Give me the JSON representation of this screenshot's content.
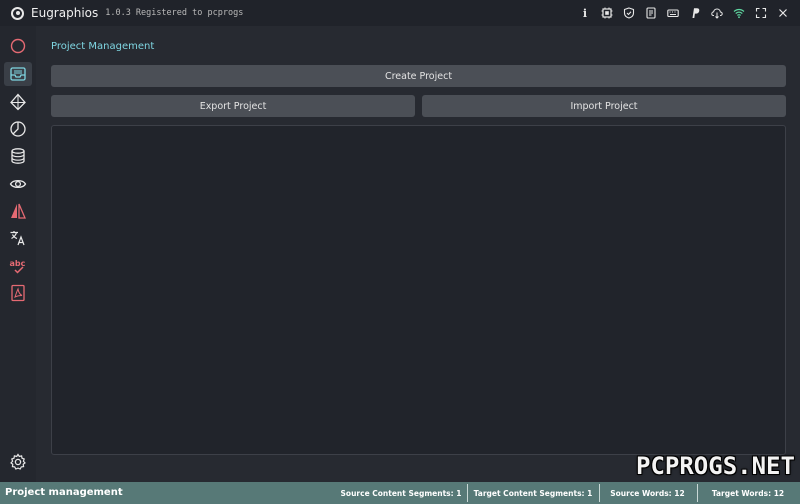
{
  "window": {
    "app_name": "Eugraphios",
    "version": "1.0.3",
    "registration": "Registered to pcprogs",
    "info_label": "i",
    "title_icons": [
      "info-icon",
      "chip-icon",
      "shield-check-icon",
      "document-icon",
      "keyboard-icon",
      "paypal-icon",
      "cloud-download-icon",
      "wifi-icon",
      "maximize-icon",
      "close-icon"
    ]
  },
  "sidebar": {
    "items": [
      {
        "icon": "circle-icon",
        "active": false
      },
      {
        "icon": "inbox-icon",
        "active": true
      },
      {
        "icon": "diamond-icon",
        "active": false
      },
      {
        "icon": "pie-chart-icon",
        "active": false
      },
      {
        "icon": "database-icon",
        "active": false
      },
      {
        "icon": "eye-icon",
        "active": false
      },
      {
        "icon": "mirror-icon",
        "active": false
      },
      {
        "icon": "translate-icon",
        "active": false
      },
      {
        "icon": "spellcheck-icon",
        "active": false
      },
      {
        "icon": "pdf-icon",
        "active": false
      }
    ],
    "settings_icon": "gear-icon"
  },
  "main": {
    "section_title": "Project Management",
    "create_label": "Create Project",
    "export_label": "Export Project",
    "import_label": "Import Project"
  },
  "status": {
    "title": "Project management",
    "source_segments": "Source Content Segments: 1",
    "target_segments": "Target Content Segments: 1",
    "source_words": "Source Words: 12",
    "target_words": "Target Words: 12"
  },
  "watermark": "PCPROGS.NET",
  "colors": {
    "accent": "#7fd6e2",
    "sidebar_icon": "#e56a73",
    "statusbar": "#577977",
    "button": "#4b4f56"
  }
}
